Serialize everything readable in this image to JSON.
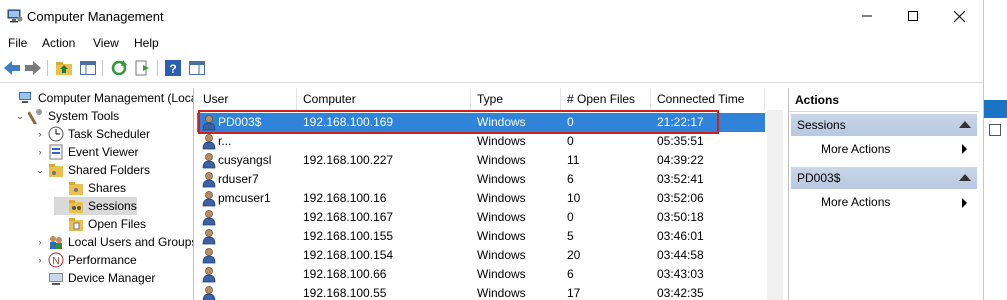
{
  "window": {
    "title": "Computer Management"
  },
  "menu": [
    "File",
    "Action",
    "View",
    "Help"
  ],
  "tree": [
    {
      "label": "Computer Management (Local",
      "level": 0,
      "exp": ""
    },
    {
      "label": "System Tools",
      "level": 1,
      "exp": "⌄"
    },
    {
      "label": "Task Scheduler",
      "level": 2,
      "exp": "›"
    },
    {
      "label": "Event Viewer",
      "level": 2,
      "exp": "›"
    },
    {
      "label": "Shared Folders",
      "level": 2,
      "exp": "⌄"
    },
    {
      "label": "Shares",
      "level": 3,
      "exp": ""
    },
    {
      "label": "Sessions",
      "level": 3,
      "exp": "",
      "selected": true
    },
    {
      "label": "Open Files",
      "level": 3,
      "exp": ""
    },
    {
      "label": "Local Users and Groups",
      "level": 2,
      "exp": "›"
    },
    {
      "label": "Performance",
      "level": 2,
      "exp": "›"
    },
    {
      "label": "Device Manager",
      "level": 2,
      "exp": ""
    }
  ],
  "columns": [
    "User",
    "Computer",
    "Type",
    "# Open Files",
    "Connected Time"
  ],
  "sessions": [
    {
      "user": "PD003$",
      "computer": "192.168.100.169",
      "type": "Windows",
      "open_files": "0",
      "time": "21:22:17",
      "selected": true
    },
    {
      "user": "r...",
      "computer": "",
      "type": "Windows",
      "open_files": "0",
      "time": "05:35:51"
    },
    {
      "user": "cusyangsl",
      "computer": "192.168.100.227",
      "type": "Windows",
      "open_files": "11",
      "time": "04:39:22"
    },
    {
      "user": "rduser7",
      "computer": "",
      "type": "Windows",
      "open_files": "6",
      "time": "03:52:41"
    },
    {
      "user": "pmcuser1",
      "computer": "192.168.100.16",
      "type": "Windows",
      "open_files": "10",
      "time": "03:52:06"
    },
    {
      "user": "",
      "computer": "192.168.100.167",
      "type": "Windows",
      "open_files": "0",
      "time": "03:50:18"
    },
    {
      "user": "",
      "computer": "192.168.100.155",
      "type": "Windows",
      "open_files": "5",
      "time": "03:46:01"
    },
    {
      "user": "",
      "computer": "192.168.100.154",
      "type": "Windows",
      "open_files": "20",
      "time": "03:44:58"
    },
    {
      "user": "",
      "computer": "192.168.100.66",
      "type": "Windows",
      "open_files": "6",
      "time": "03:43:03"
    },
    {
      "user": "",
      "computer": "192.168.100.55",
      "type": "Windows",
      "open_files": "17",
      "time": "03:42:35"
    }
  ],
  "actions": {
    "title": "Actions",
    "sections": [
      {
        "name": "Sessions",
        "item": "More Actions"
      },
      {
        "name": "PD003$",
        "item": "More Actions"
      }
    ]
  },
  "colors": {
    "selection": "#2f83d9",
    "highlight_box": "#d02020",
    "section_header": "#c9d6e8"
  }
}
